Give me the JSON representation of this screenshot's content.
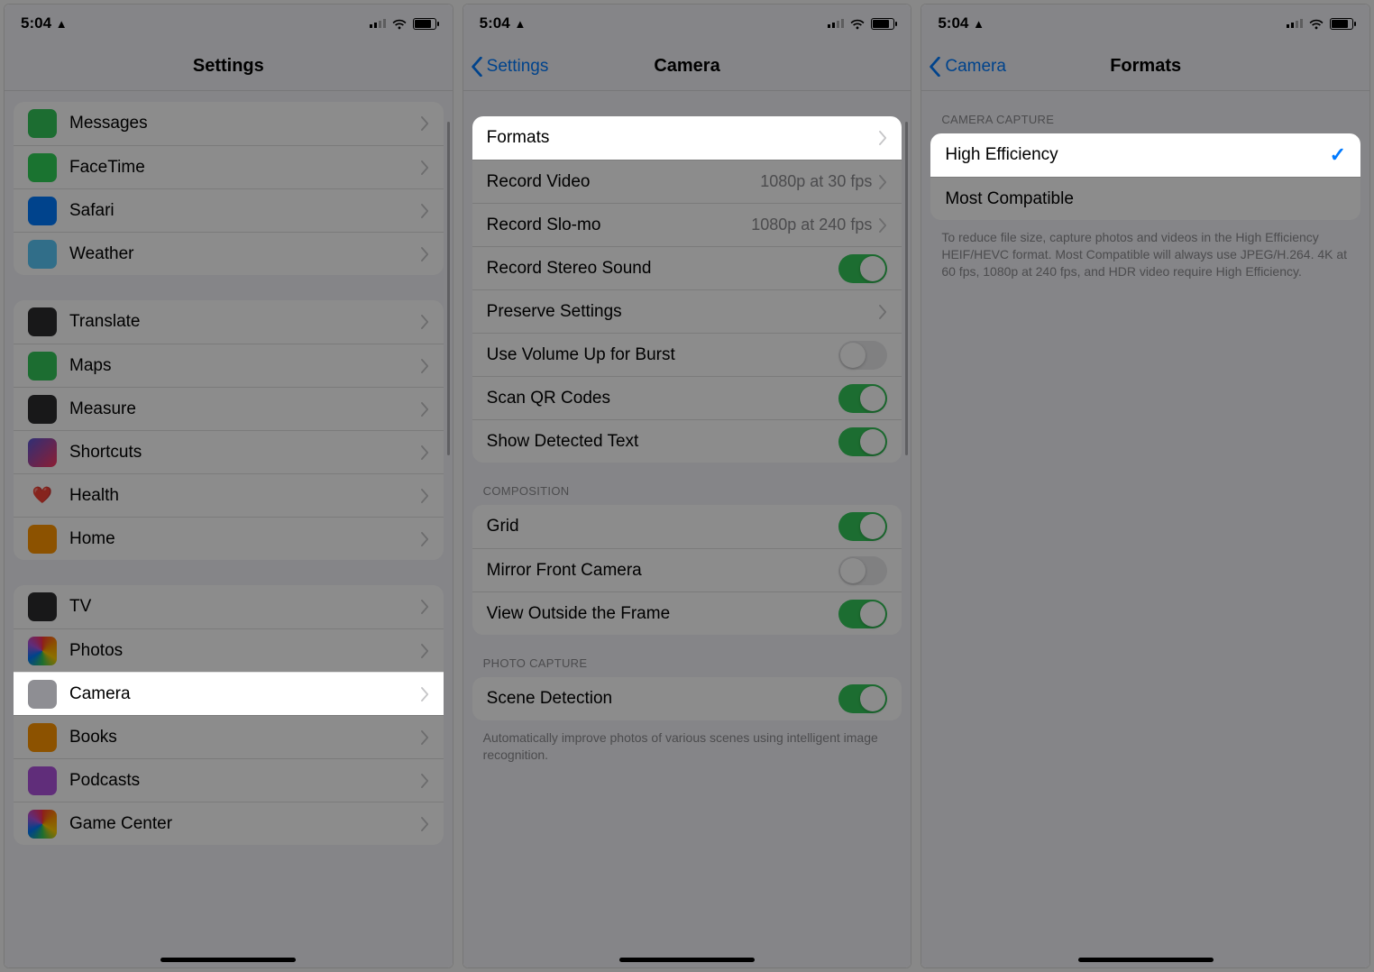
{
  "status": {
    "time": "5:04",
    "person": "👤"
  },
  "screen1": {
    "title": "Settings",
    "groups": [
      [
        {
          "icon": "messages-icon",
          "label": "Messages",
          "bg": "ic-green"
        },
        {
          "icon": "facetime-icon",
          "label": "FaceTime",
          "bg": "ic-green2"
        },
        {
          "icon": "safari-icon",
          "label": "Safari",
          "bg": "ic-blue"
        },
        {
          "icon": "weather-icon",
          "label": "Weather",
          "bg": "ic-lblue"
        }
      ],
      [
        {
          "icon": "translate-icon",
          "label": "Translate",
          "bg": "ic-dark"
        },
        {
          "icon": "maps-icon",
          "label": "Maps",
          "bg": "ic-green"
        },
        {
          "icon": "measure-icon",
          "label": "Measure",
          "bg": "ic-dark"
        },
        {
          "icon": "shortcuts-icon",
          "label": "Shortcuts",
          "bg": "ic-mix"
        },
        {
          "icon": "health-icon",
          "label": "Health",
          "bg": "",
          "glyph": "❤️"
        },
        {
          "icon": "home-icon",
          "label": "Home",
          "bg": "ic-orange"
        }
      ],
      [
        {
          "icon": "tv-icon",
          "label": "TV",
          "bg": "ic-dark"
        },
        {
          "icon": "photos-icon",
          "label": "Photos",
          "bg": "ic-rainbow"
        },
        {
          "icon": "camera-icon",
          "label": "Camera",
          "bg": "ic-gray",
          "highlight": true
        },
        {
          "icon": "books-icon",
          "label": "Books",
          "bg": "ic-orange"
        },
        {
          "icon": "podcasts-icon",
          "label": "Podcasts",
          "bg": "ic-purple"
        },
        {
          "icon": "gamecenter-icon",
          "label": "Game Center",
          "bg": "ic-rainbow"
        }
      ]
    ]
  },
  "screen2": {
    "back": "Settings",
    "title": "Camera",
    "rows1": [
      {
        "label": "Formats",
        "type": "disclosure",
        "highlight": true
      },
      {
        "label": "Record Video",
        "type": "detail",
        "detail": "1080p at 30 fps"
      },
      {
        "label": "Record Slo-mo",
        "type": "detail",
        "detail": "1080p at 240 fps"
      },
      {
        "label": "Record Stereo Sound",
        "type": "toggle",
        "on": true
      },
      {
        "label": "Preserve Settings",
        "type": "disclosure"
      },
      {
        "label": "Use Volume Up for Burst",
        "type": "toggle",
        "on": false
      },
      {
        "label": "Scan QR Codes",
        "type": "toggle",
        "on": true
      },
      {
        "label": "Show Detected Text",
        "type": "toggle",
        "on": true
      }
    ],
    "composition_header": "COMPOSITION",
    "rows2": [
      {
        "label": "Grid",
        "type": "toggle",
        "on": true
      },
      {
        "label": "Mirror Front Camera",
        "type": "toggle",
        "on": false
      },
      {
        "label": "View Outside the Frame",
        "type": "toggle",
        "on": true
      }
    ],
    "photo_header": "PHOTO CAPTURE",
    "rows3": [
      {
        "label": "Scene Detection",
        "type": "toggle",
        "on": true
      }
    ],
    "footer3": "Automatically improve photos of various scenes using intelligent image recognition."
  },
  "screen3": {
    "back": "Camera",
    "title": "Formats",
    "section_header": "CAMERA CAPTURE",
    "options": [
      {
        "label": "High Efficiency",
        "selected": true,
        "highlight": true
      },
      {
        "label": "Most Compatible",
        "selected": false
      }
    ],
    "footer": "To reduce file size, capture photos and videos in the High Efficiency HEIF/HEVC format. Most Compatible will always use JPEG/H.264. 4K at 60 fps, 1080p at 240 fps, and HDR video require High Efficiency."
  }
}
